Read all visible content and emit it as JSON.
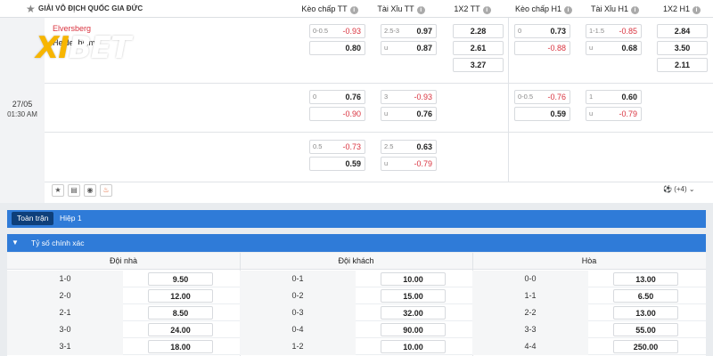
{
  "header": {
    "league": "GIẢI VÔ ĐỊCH QUỐC GIA ĐỨC",
    "columns": [
      "Kèo chấp TT",
      "Tài Xỉu TT",
      "1X2 TT",
      "Kèo chấp H1",
      "Tài Xỉu H1",
      "1X2 H1"
    ]
  },
  "match": {
    "team_home": "Elversberg",
    "team_away": "Heidenheim",
    "date": "27/05",
    "time": "01:30 AM",
    "more_label": "(+4)"
  },
  "logo": {
    "text_x": "XI",
    "text_rest": "BET"
  },
  "odds_rows": [
    {
      "kc_tt": {
        "top_hc": "0-0.5",
        "top": "-0.93",
        "bot_hc": "",
        "bot": "0.80"
      },
      "tx_tt": {
        "top_hc": "2.5-3",
        "top": "0.97",
        "bot_hc": "u",
        "bot": "0.87"
      },
      "x12_tt": [
        "2.28",
        "2.61",
        "3.27"
      ],
      "kc_h1": {
        "top_hc": "0",
        "top": "0.73",
        "bot_hc": "",
        "bot": "-0.88"
      },
      "tx_h1": {
        "top_hc": "1-1.5",
        "top": "-0.85",
        "bot_hc": "u",
        "bot": "0.68"
      },
      "x12_h1": [
        "2.84",
        "3.50",
        "2.11"
      ]
    },
    {
      "kc_tt": {
        "top_hc": "0",
        "top": "0.76",
        "bot_hc": "",
        "bot": "-0.90"
      },
      "tx_tt": {
        "top_hc": "3",
        "top": "-0.93",
        "bot_hc": "u",
        "bot": "0.76"
      },
      "kc_h1": {
        "top_hc": "0-0.5",
        "top": "-0.76",
        "bot_hc": "",
        "bot": "0.59"
      },
      "tx_h1": {
        "top_hc": "1",
        "top": "0.60",
        "bot_hc": "u",
        "bot": "-0.79"
      }
    },
    {
      "kc_tt": {
        "top_hc": "0.5",
        "top": "-0.73",
        "bot_hc": "",
        "bot": "0.59"
      },
      "tx_tt": {
        "top_hc": "2.5",
        "top": "0.63",
        "bot_hc": "u",
        "bot": "-0.79"
      }
    }
  ],
  "tabs": {
    "active": "Toàn trận",
    "other": "Hiệp 1"
  },
  "section_title": "Tỷ số chính xác",
  "table": {
    "headers": [
      "Đội nhà",
      "Đội khách",
      "Hòa"
    ],
    "rows": [
      {
        "h_score": "1-0",
        "h_odds": "9.50",
        "a_score": "0-1",
        "a_odds": "10.00",
        "d_score": "0-0",
        "d_odds": "13.00"
      },
      {
        "h_score": "2-0",
        "h_odds": "12.00",
        "a_score": "0-2",
        "a_odds": "15.00",
        "d_score": "1-1",
        "d_odds": "6.50"
      },
      {
        "h_score": "2-1",
        "h_odds": "8.50",
        "a_score": "0-3",
        "a_odds": "32.00",
        "d_score": "2-2",
        "d_odds": "13.00"
      },
      {
        "h_score": "3-0",
        "h_odds": "24.00",
        "a_score": "0-4",
        "a_odds": "90.00",
        "d_score": "3-3",
        "d_odds": "55.00"
      },
      {
        "h_score": "3-1",
        "h_odds": "18.00",
        "a_score": "1-2",
        "a_odds": "10.00",
        "d_score": "4-4",
        "d_odds": "250.00"
      }
    ]
  },
  "colors": {
    "accent": "#2f7bd8",
    "negative": "#d9333f",
    "tab_active": "#0e3f7a"
  }
}
